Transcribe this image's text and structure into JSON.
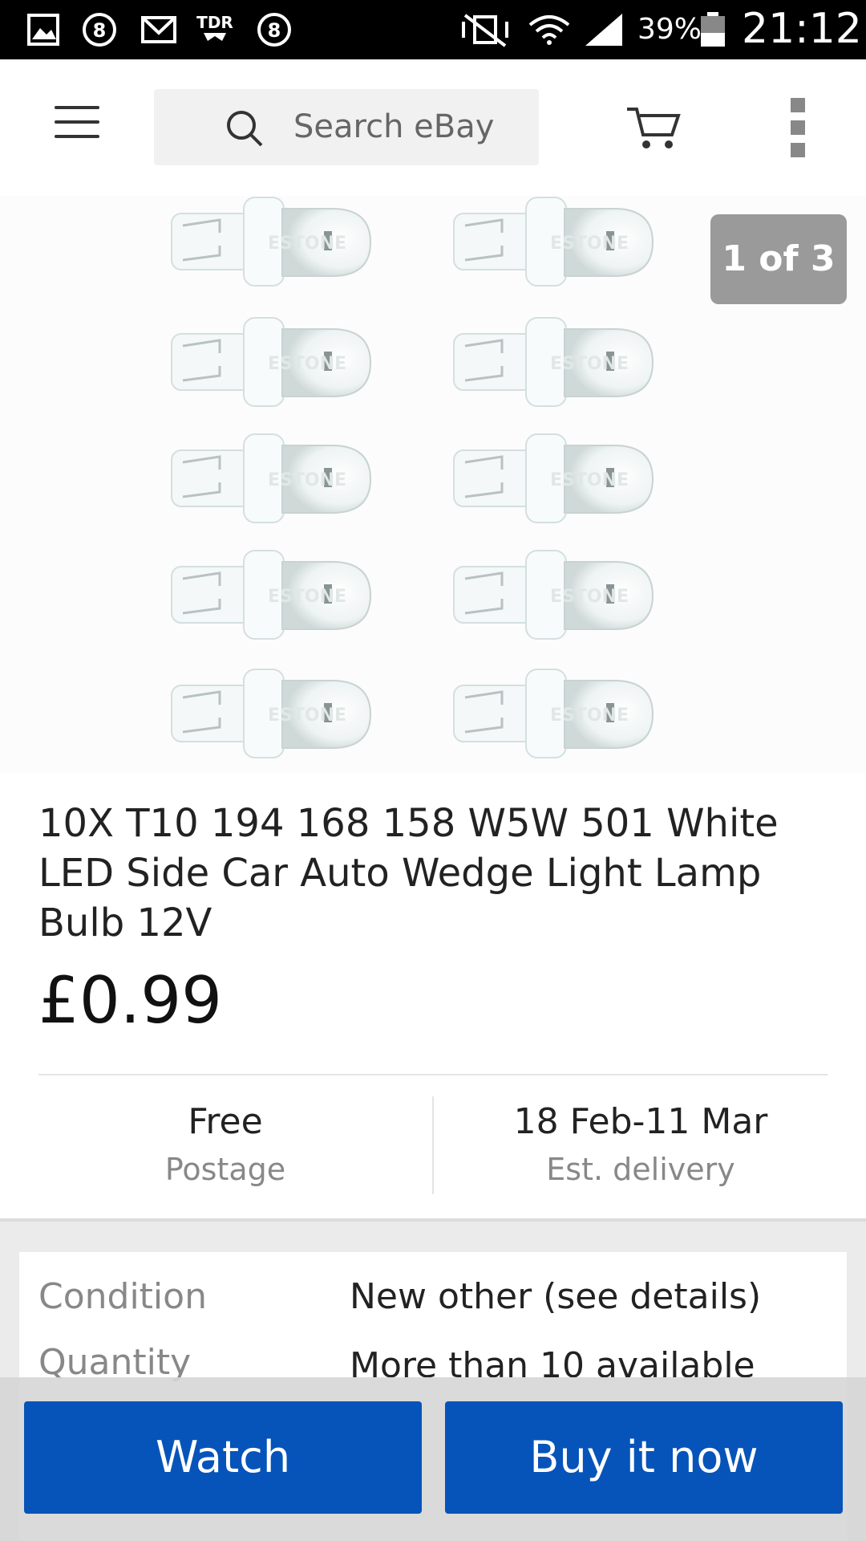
{
  "status_bar": {
    "battery": "39%",
    "time": "21:12"
  },
  "header": {
    "search_placeholder": "Search eBay"
  },
  "gallery": {
    "counter": "1 of 3"
  },
  "product": {
    "title": "10X T10 194 168 158 W5W 501 White LED Side Car Auto Wedge Light Lamp Bulb 12V",
    "price": "£0.99"
  },
  "shipping": {
    "postage_value": "Free",
    "postage_label": "Postage",
    "delivery_value": "18 Feb-11 Mar",
    "delivery_label": "Est. delivery"
  },
  "details": [
    {
      "label": "Condition",
      "value": "New other (see details)"
    },
    {
      "label": "Quantity",
      "value": "More than 10 available"
    }
  ],
  "actions": {
    "watch": "Watch",
    "buy": "Buy it now"
  },
  "colors": {
    "primary_button": "#0654ba",
    "status_bar": "#000000"
  }
}
